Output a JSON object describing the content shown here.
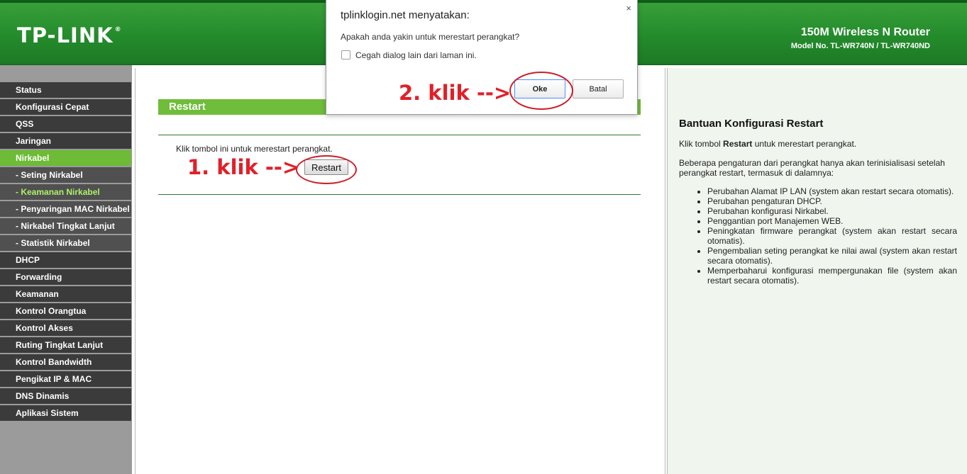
{
  "header": {
    "logo": "TP-LINK",
    "logo_mark": "®",
    "product_title": "150M Wireless N Router",
    "model": "Model No. TL-WR740N / TL-WR740ND"
  },
  "sidebar": {
    "items": [
      {
        "label": "Status"
      },
      {
        "label": "Konfigurasi Cepat"
      },
      {
        "label": "QSS"
      },
      {
        "label": "Jaringan"
      },
      {
        "label": "Nirkabel"
      },
      {
        "label": "- Seting Nirkabel"
      },
      {
        "label": "- Keamanan Nirkabel"
      },
      {
        "label": "- Penyaringan MAC Nirkabel"
      },
      {
        "label": "- Nirkabel Tingkat Lanjut"
      },
      {
        "label": "- Statistik Nirkabel"
      },
      {
        "label": "DHCP"
      },
      {
        "label": "Forwarding"
      },
      {
        "label": "Keamanan"
      },
      {
        "label": "Kontrol Orangtua"
      },
      {
        "label": "Kontrol Akses"
      },
      {
        "label": "Ruting Tingkat Lanjut"
      },
      {
        "label": "Kontrol Bandwidth"
      },
      {
        "label": "Pengikat IP & MAC"
      },
      {
        "label": "DNS Dinamis"
      },
      {
        "label": "Aplikasi Sistem"
      }
    ]
  },
  "main": {
    "section_title": "Restart",
    "description": "Klik tombol ini untuk merestart perangkat.",
    "restart_button": "Restart"
  },
  "annotations": {
    "step1": "1. klik -->",
    "step2": "2. klik -->",
    "color": "#e0202a"
  },
  "dialog": {
    "title": "tplinklogin.net menyatakan:",
    "close": "×",
    "message": "Apakah anda yakin untuk merestart perangkat?",
    "checkbox_label": "Cegah dialog lain dari laman ini.",
    "ok": "Oke",
    "cancel": "Batal"
  },
  "help": {
    "title": "Bantuan Konfigurasi Restart",
    "p1_pre": "Klik tombol ",
    "p1_bold": "Restart",
    "p1_post": " untuk merestart perangkat.",
    "p2": "Beberapa pengaturan dari perangkat hanya akan terinisialisasi setelah perangkat restart, termasuk di dalamnya:",
    "items": [
      "Perubahan Alamat IP LAN (system akan restart secara otomatis).",
      "Perubahan pengaturan DHCP.",
      "Perubahan konfigurasi Nirkabel.",
      "Penggantian port Manajemen WEB.",
      "Peningkatan firmware perangkat (system akan restart secara otomatis).",
      "Pengembalian seting perangkat ke nilai awal (system akan restart secara otomatis).",
      "Memperbaharui konfigurasi mempergunakan file (system akan restart secara otomatis)."
    ]
  },
  "colors": {
    "brand_green": "#248c2c",
    "menu_active": "#6dbb36",
    "menu_dark": "#3b3b3b",
    "submenu_current": "#aef06a"
  }
}
